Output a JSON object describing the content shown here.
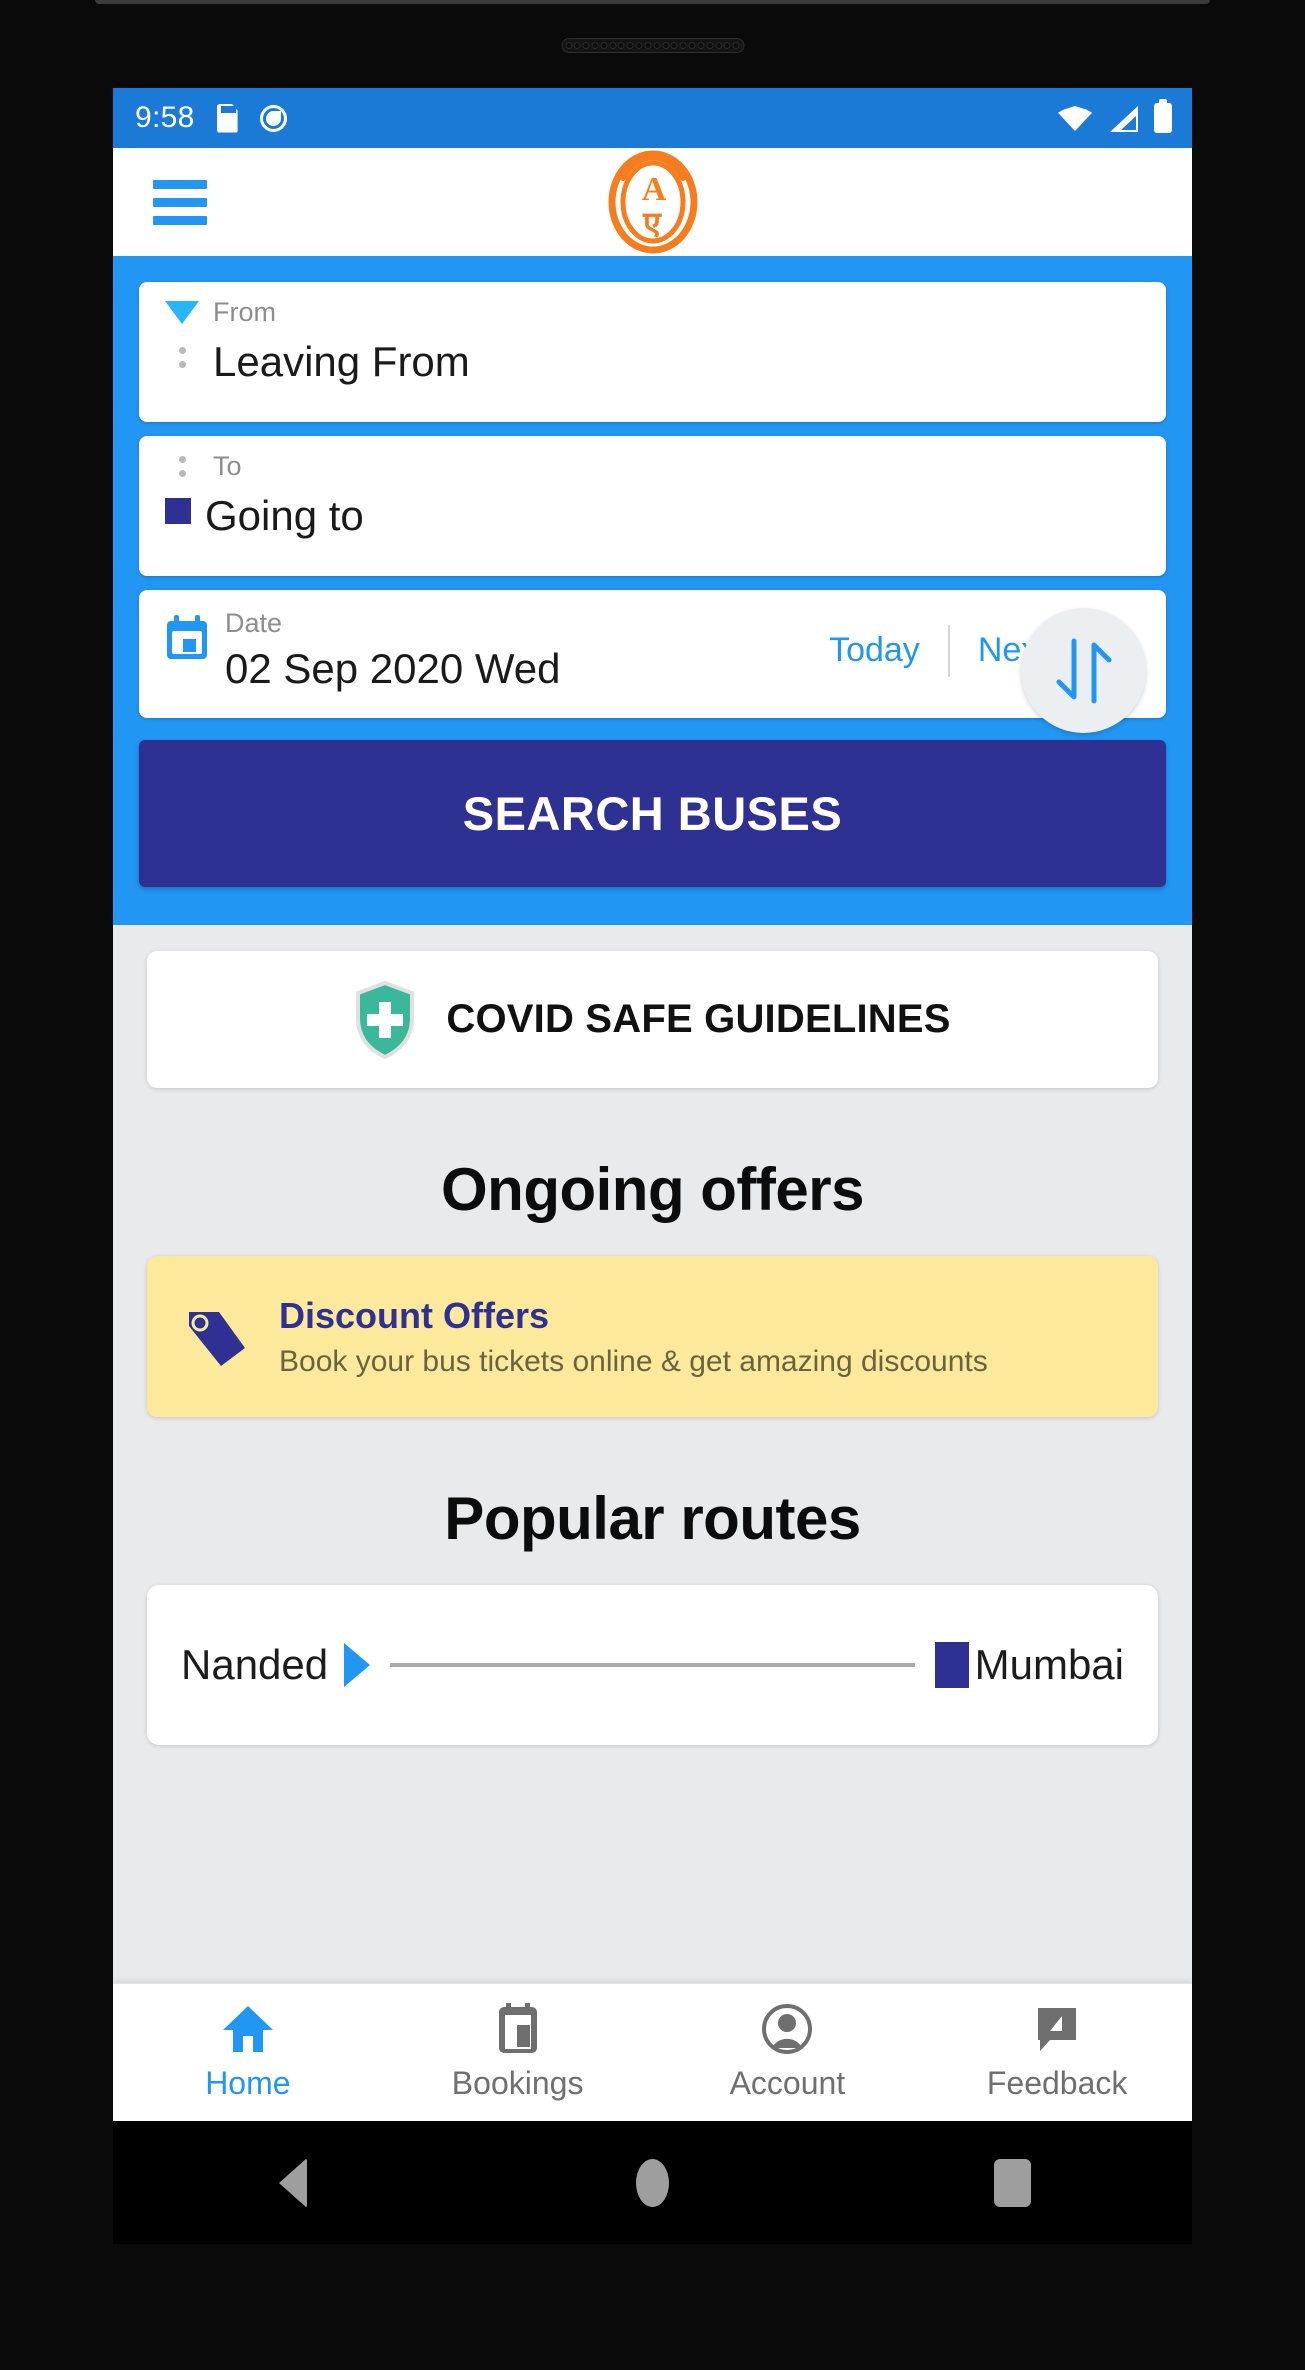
{
  "status_bar": {
    "time": "9:58",
    "left_icons": [
      "sdcard-icon",
      "location-disabled-icon"
    ],
    "right_icons": [
      "wifi-icon",
      "signal-icon",
      "battery-icon"
    ],
    "background_color": "#1b7ad6"
  },
  "app_bar": {
    "menu_icon": "hamburger-menu-icon",
    "logo_icon": "app-logo-icon",
    "logo_color": "#f57c1f",
    "background_color": "#ffffff"
  },
  "search_panel": {
    "background_color": "#2196f3",
    "from": {
      "label": "From",
      "value": "Leaving From",
      "marker_icon": "triangle-marker-icon",
      "marker_color": "#29b6f6"
    },
    "to": {
      "label": "To",
      "value": "Going to",
      "marker_icon": "square-marker-icon",
      "marker_color": "#2f3192"
    },
    "swap_icon": "swap-vertical-arrows-icon",
    "date": {
      "label": "Date",
      "value": "02 Sep 2020 Wed",
      "icon": "calendar-icon",
      "today_label": "Today",
      "next_day_label": "Next day"
    },
    "search_button_label": "SEARCH BUSES",
    "search_button_color": "#2f3192"
  },
  "covid_banner": {
    "label": "COVID SAFE GUIDELINES",
    "icon": "shield-plus-icon",
    "icon_color": "#3bb79a"
  },
  "offers": {
    "section_title": "Ongoing offers",
    "card": {
      "title": "Discount Offers",
      "subtitle": "Book your bus tickets online & get amazing discounts",
      "icon": "price-tag-icon",
      "background_color": "#fce99c",
      "title_color": "#2f3192"
    }
  },
  "popular_routes": {
    "section_title": "Popular routes",
    "routes": [
      {
        "origin": "Nanded",
        "destination": "Mumbai"
      }
    ]
  },
  "tab_bar": {
    "tabs": [
      {
        "label": "Home",
        "icon": "home-icon",
        "active": true
      },
      {
        "label": "Bookings",
        "icon": "ticket-icon",
        "active": false
      },
      {
        "label": "Account",
        "icon": "account-icon",
        "active": false
      },
      {
        "label": "Feedback",
        "icon": "feedback-icon",
        "active": false
      }
    ],
    "active_color": "#2196f3",
    "inactive_color": "#6f6f6f"
  },
  "android_nav": {
    "buttons": [
      "back-button",
      "home-button",
      "recents-button"
    ]
  }
}
